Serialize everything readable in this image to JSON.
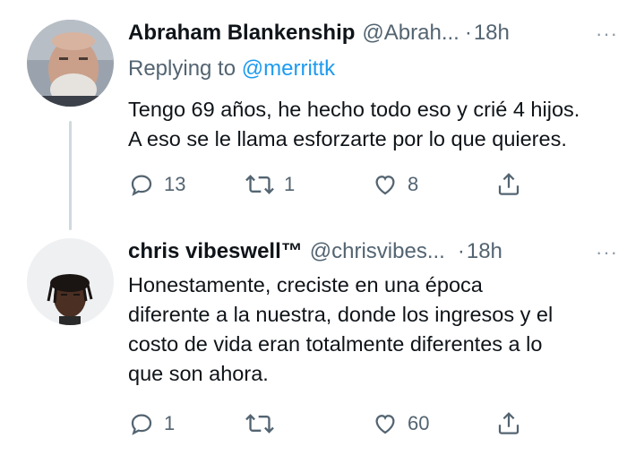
{
  "tweets": [
    {
      "author_name": "Abraham Blankenship",
      "author_handle": "@Abrah...",
      "dot": "·",
      "time": "18h",
      "more": "···",
      "replying_label": "Replying to",
      "replying_to": "@merrittk",
      "text_lines": [
        "Tengo 69 años, he hecho todo eso y crié 4 hijos.",
        "A eso se le llama esforzarte por lo que quieres."
      ],
      "replies": "13",
      "retweets": "1",
      "likes": "8"
    },
    {
      "author_name": "chris vibeswell™",
      "author_handle": "@chrisvibes...",
      "dot": "·",
      "time": "18h",
      "more": "···",
      "text_lines": [
        "Honestamente, creciste en una época",
        "diferente a la nuestra, donde los ingresos y el",
        "costo de vida eran totalmente diferentes a lo",
        "que son ahora."
      ],
      "replies": "1",
      "retweets": "",
      "likes": "60"
    }
  ],
  "colors": {
    "text": "#0f1419",
    "secondary": "#536471",
    "link": "#1d9bf0",
    "thread_line": "#cfd9de"
  }
}
